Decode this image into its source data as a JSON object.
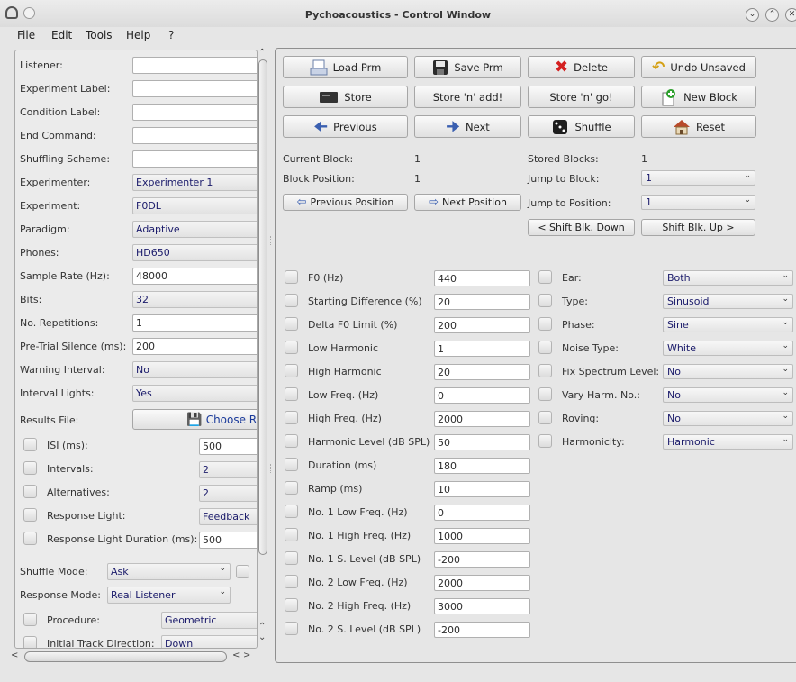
{
  "window": {
    "title": "Pychoacoustics - Control Window",
    "controls": [
      "⌄",
      "⌃",
      "✕"
    ]
  },
  "menu": [
    "File",
    "Edit",
    "Tools",
    "Help",
    "?"
  ],
  "left": {
    "text_fields": [
      {
        "label": "Listener:",
        "value": ""
      },
      {
        "label": "Experiment Label:",
        "value": ""
      },
      {
        "label": "Condition Label:",
        "value": ""
      },
      {
        "label": "End Command:",
        "value": ""
      },
      {
        "label": "Shuffling Scheme:",
        "value": ""
      }
    ],
    "experimenter": {
      "label": "Experimenter:",
      "value": "Experimenter 1"
    },
    "experiment": {
      "label": "Experiment:",
      "value": "F0DL"
    },
    "paradigm": {
      "label": "Paradigm:",
      "value": "Adaptive"
    },
    "phones": {
      "label": "Phones:",
      "value": "HD650"
    },
    "sample_rate": {
      "label": "Sample Rate (Hz):",
      "value": "48000"
    },
    "bits": {
      "label": "Bits:",
      "value": "32"
    },
    "repetitions": {
      "label": "No. Repetitions:",
      "value": "1"
    },
    "pretrial": {
      "label": "Pre-Trial Silence (ms):",
      "value": "200"
    },
    "warning": {
      "label": "Warning Interval:",
      "value": "No"
    },
    "interval_lights": {
      "label": "Interval Lights:",
      "value": "Yes"
    },
    "results_file": {
      "label": "Results File:",
      "button": "Choose Re"
    },
    "isi": {
      "label": "ISI (ms):",
      "value": "500"
    },
    "intervals": {
      "label": "Intervals:",
      "value": "2"
    },
    "alternatives": {
      "label": "Alternatives:",
      "value": "2"
    },
    "response_light": {
      "label": "Response Light:",
      "value": "Feedback"
    },
    "response_light_duration": {
      "label": "Response Light Duration (ms):",
      "value": "500"
    },
    "shuffle_mode": {
      "label": "Shuffle Mode:",
      "value": "Ask"
    },
    "response_mode": {
      "label": "Response Mode:",
      "value": "Real Listener"
    },
    "procedure": {
      "label": "Procedure:",
      "value": "Geometric"
    },
    "initial_track": {
      "label": "Initial Track Direction:",
      "value": "Down"
    }
  },
  "toolbar": {
    "load_prm": "Load Prm",
    "save_prm": "Save Prm",
    "delete": "Delete",
    "undo_unsaved": "Undo Unsaved",
    "store": "Store",
    "store_n_add": "Store 'n' add!",
    "store_n_go": "Store 'n' go!",
    "new_block": "New Block",
    "previous": "Previous",
    "next": "Next",
    "shuffle": "Shuffle",
    "reset": "Reset"
  },
  "blocks": {
    "current_block_label": "Current Block:",
    "current_block": "1",
    "stored_blocks_label": "Stored Blocks:",
    "stored_blocks": "1",
    "block_position_label": "Block Position:",
    "block_position": "1",
    "jump_to_block_label": "Jump to Block:",
    "jump_to_block": "1",
    "jump_to_position_label": "Jump to Position:",
    "jump_to_position": "1",
    "previous_position": "Previous Position",
    "next_position": "Next Position",
    "shift_down": "< Shift Blk. Down",
    "shift_up": "Shift Blk. Up >"
  },
  "params": [
    {
      "label": "F0 (Hz)",
      "value": "440"
    },
    {
      "label": "Starting Difference (%)",
      "value": "20"
    },
    {
      "label": "Delta F0 Limit (%)",
      "value": "200"
    },
    {
      "label": "Low Harmonic",
      "value": "1"
    },
    {
      "label": "High Harmonic",
      "value": "20"
    },
    {
      "label": "Low Freq. (Hz)",
      "value": "0"
    },
    {
      "label": "High Freq. (Hz)",
      "value": "2000"
    },
    {
      "label": "Harmonic Level (dB SPL)",
      "value": "50"
    },
    {
      "label": "Duration (ms)",
      "value": "180"
    },
    {
      "label": "Ramp (ms)",
      "value": "10"
    },
    {
      "label": "No. 1 Low Freq. (Hz)",
      "value": "0"
    },
    {
      "label": "No. 1 High Freq. (Hz)",
      "value": "1000"
    },
    {
      "label": "No. 1 S. Level (dB SPL)",
      "value": "-200"
    },
    {
      "label": "No. 2 Low Freq. (Hz)",
      "value": "2000"
    },
    {
      "label": "No. 2 High Freq. (Hz)",
      "value": "3000"
    },
    {
      "label": "No. 2 S. Level (dB SPL)",
      "value": "-200"
    }
  ],
  "choosers": [
    {
      "label": "Ear:",
      "value": "Both"
    },
    {
      "label": "Type:",
      "value": "Sinusoid"
    },
    {
      "label": "Phase:",
      "value": "Sine"
    },
    {
      "label": "Noise Type:",
      "value": "White"
    },
    {
      "label": "Fix Spectrum Level:",
      "value": "No"
    },
    {
      "label": "Vary Harm. No.:",
      "value": "No"
    },
    {
      "label": "Roving:",
      "value": "No"
    },
    {
      "label": "Harmonicity:",
      "value": "Harmonic"
    }
  ],
  "colors": {
    "combo_text": "#1a1a6a",
    "delete_icon": "#d42020",
    "new_block_icon": "#2da02d",
    "arrow_icon": "#3a5fb0"
  }
}
